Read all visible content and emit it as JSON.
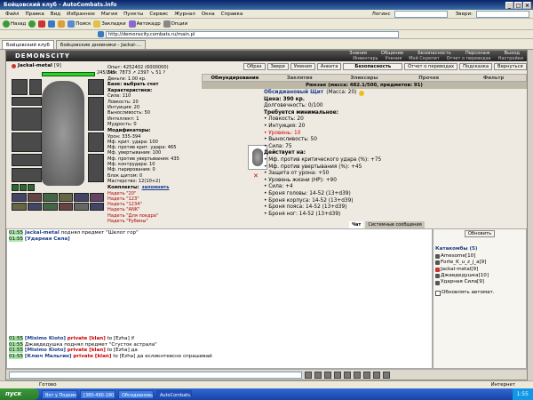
{
  "window": {
    "title": "Бойцовский клуб - AutoCombats.info"
  },
  "menu": {
    "items": [
      "Файл",
      "Правка",
      "Вид",
      "Избранное",
      "Магия",
      "Пункты",
      "Сервис",
      "Журнал",
      "Окна",
      "Справка"
    ],
    "logins_label": "Логинс",
    "links_label": "Звери:"
  },
  "toolbar": {
    "back": "Назад",
    "search": "Поиск",
    "favorites": "Закладки",
    "autofill": "Автокадр",
    "options": "Опции",
    "address": "http://demonscity.combats.ru/main.pl"
  },
  "tabs": [
    {
      "label": "Бойцовский клуб"
    },
    {
      "label": "Бойцовские дневники - Jackal-..."
    }
  ],
  "game": {
    "logo": "DEMONSCITY",
    "nav_top": [
      "Знания",
      "Общение",
      "Безопасность",
      "Персонаж",
      "Выход"
    ],
    "nav_sub": [
      "Инвентарь",
      "Учения",
      "Мой Скрепит",
      "Отчет о переводах",
      "Настройки"
    ],
    "player": {
      "name": "Jackal-metal",
      "level": "[9]",
      "hp": "245/245"
    },
    "buttons_top": [
      "Образ",
      "Звери",
      "Умения",
      "Анкета",
      "Безопасность",
      "Отчет о переводах",
      "Подсказка",
      "Вернуться"
    ],
    "inv_tabs": [
      "Обмундирование",
      "Заклятия",
      "Эликсиры",
      "Прочее",
      "Фильтр"
    ],
    "backpack_label": "Рюкзак (масса: 482.1/500, предметов: 91)",
    "stats": [
      "Опыт: 4252402 (6000000)",
      "Бои: 7873 ↗  2397 ↘  51 ?",
      "Деньги: 1.00 кр.",
      "Банк: выбрать счет"
    ],
    "char_head": "Характеристики:",
    "char": [
      "Сила: 110",
      "Ловкость: 20",
      "Интуиция: 20",
      "Выносливость: 50",
      "Интеллект: 1",
      "Мудрость: 0"
    ],
    "mod_head": "Модификаторы:",
    "mods": [
      "Урон: 335-394",
      "Мф. крит. удара: 100",
      "Мф. против крит. удара: 465",
      "Мф. увертывания: 100",
      "Мф. против увертывания: 435",
      "Мф. контрудара: 10",
      "Мф. парирования: 0",
      "Блок щитом: 0",
      "Мастерство: 12(10+2)"
    ],
    "sets_head": "Комплекты:",
    "sets_action": "запомнить",
    "sets": [
      "Надеть \"20\"",
      "Надеть \"123\"",
      "Надеть \"1234\"",
      "Надеть \"ANK\"",
      "Надеть \"Для поедра\"",
      "Надеть \"Рубины\""
    ],
    "item": {
      "name": "Обсидиановый Щит",
      "weight": "(Масса: 20)",
      "price": "Цена: 390 кр.",
      "durability": "Долговечность: 0/100",
      "req_head": "Требуется минимальное:",
      "reqs": [
        "• Ловкость: 20",
        "• Интуиция: 20",
        "• Уровень: 10",
        "• Выносливость: 50",
        "• Сила: 75"
      ],
      "req_red_index": 2,
      "act_head": "Действует на:",
      "acts": [
        "• Мф. против критического удара (%): +75",
        "• Мф. против увертывания (%): +45",
        "• Защита от урона: +50",
        "• Уровень жизни (HP): +90",
        "• Сила: +4",
        "• Броня головы: 14-52 (13+d39)",
        "• Броня корпуса: 14-52 (13+d39)",
        "• Броня пояса: 14-52 (13+d39)",
        "• Броня ног: 14-52 (13+d39)"
      ]
    }
  },
  "chat": {
    "tabs": [
      "Чат",
      "Системные сообщения"
    ],
    "lines_top": [
      {
        "time": "01:55",
        "name": "Jackal-metal",
        "text": "поднял предмет \"Шелот гор\""
      },
      {
        "time": "01:55",
        "name": "[Ударная Сила]",
        "text": ""
      }
    ],
    "lines_bottom": [
      {
        "time": "01:55",
        "name": "[Misimo Kioto]",
        "private": "private [klan]",
        "text": "to [Ezha] if"
      },
      {
        "time": "01:55",
        "name": "Джавдедушка",
        "private": "",
        "text": "поднял предмет \"Сгусток астрала\""
      },
      {
        "time": "01:55",
        "name": "[Misimo Kioto]",
        "private": "private [klan]",
        "text": "to [Ezha] да"
      },
      {
        "time": "01:55",
        "name": "[Ключ Мальгин]",
        "private": "private [klan]",
        "text": "to [Ezha] да есликнтевсно спрашивай"
      }
    ]
  },
  "sidebar": {
    "refresh": "Обновить",
    "location": "Катакомбы (5)",
    "players": [
      "Amesome[10]",
      "Forte_K_u_z_j_a[9]",
      "Jackal-metal[9]",
      "Джавдедушка[10]",
      "Ударная Сила[9]"
    ],
    "auto_refresh": "Обновлять автомат."
  },
  "status": {
    "left": "Готово",
    "right": "Интернет"
  },
  "taskbar": {
    "start": "пуск",
    "tasks": [
      "Вот у Подкинащих Di...",
      "[380-490-180] - Ожно...",
      "Обсидиановый щит -...",
      "AutoCombats.info"
    ],
    "clock": "1:55"
  },
  "colors": {
    "accent": "#1b3d8a",
    "red": "#c00000",
    "chat_time_bg": "#a8e6a8"
  }
}
